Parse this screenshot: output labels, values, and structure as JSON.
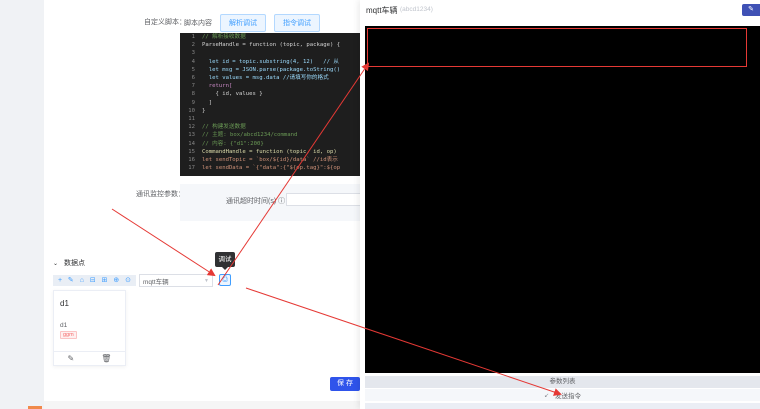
{
  "form": {
    "script_label": "自定义脚本：",
    "script_content_label": "脚本内容",
    "parse_debug_button": "解析调试",
    "command_debug_button": "指令调试",
    "monitor_label": "通讯监控参数：",
    "timeout_label": "通讯超时时间(s) ⓘ :"
  },
  "code_lines": [
    {
      "n": "1",
      "text": "// 解析接收数据",
      "color": "#6a9955"
    },
    {
      "n": "2",
      "text": "ParseHandle = function (topic, package) {",
      "color": "#d4d4d4"
    },
    {
      "n": "3",
      "text": "",
      "color": "#d4d4d4"
    },
    {
      "n": "4",
      "text": "  let id = topic.substring(4, 12)   // 从",
      "color": "#9cdcfe"
    },
    {
      "n": "5",
      "text": "  let msg = JSON.parse(package.toString()",
      "color": "#9cdcfe"
    },
    {
      "n": "6",
      "text": "  let values = msg.data //请填写你的格式",
      "color": "#9cdcfe"
    },
    {
      "n": "7",
      "text": "  return[",
      "color": "#c586c0"
    },
    {
      "n": "8",
      "text": "    { id, values }",
      "color": "#d4d4d4"
    },
    {
      "n": "9",
      "text": "  ]",
      "color": "#d4d4d4"
    },
    {
      "n": "10",
      "text": "}",
      "color": "#d4d4d4"
    },
    {
      "n": "11",
      "text": "",
      "color": "#d4d4d4"
    },
    {
      "n": "12",
      "text": "// 构建发送数据",
      "color": "#6a9955"
    },
    {
      "n": "13",
      "text": "// 主题: box/abcd1234/command",
      "color": "#6a9955"
    },
    {
      "n": "14",
      "text": "// 内容: {\"d1\":200}",
      "color": "#6a9955"
    },
    {
      "n": "15",
      "text": "CommandHandle = function (topic, id, op)",
      "color": "#dcdcaa"
    },
    {
      "n": "16",
      "text": "let sendTopic = `box/${id}/data` //id表示",
      "color": "#ce9178"
    },
    {
      "n": "17",
      "text": "let sendData = `{\"data\":{\"${op.tag}\":${op",
      "color": "#ce9178"
    }
  ],
  "datapoints": {
    "header": "数据点",
    "chevron": "⌄",
    "toolbar_icons": [
      "+",
      "✎",
      "⌂",
      "⊟",
      "⊞",
      "⊕",
      "⊙"
    ],
    "select_value": "mqtt车辆",
    "select_arrow": "▼",
    "debug_icon": "⎙",
    "tooltip": "调试",
    "card": {
      "title": "d1",
      "sub": "d1",
      "tag": "ggm"
    },
    "card_actions": [
      "✎",
      "🗑"
    ]
  },
  "save_button": "保 存",
  "drawer": {
    "title": "mqtt车辆",
    "subtitle": "(abcd1234)",
    "edit_icon": "✎",
    "param_list": "参数列表",
    "send_icon": "↙",
    "send_command": "发送指令"
  },
  "colors": {
    "accent": "#409eff",
    "primary_button": "#2f54eb",
    "highlight_box": "#e53935",
    "console_bg": "#000000"
  }
}
